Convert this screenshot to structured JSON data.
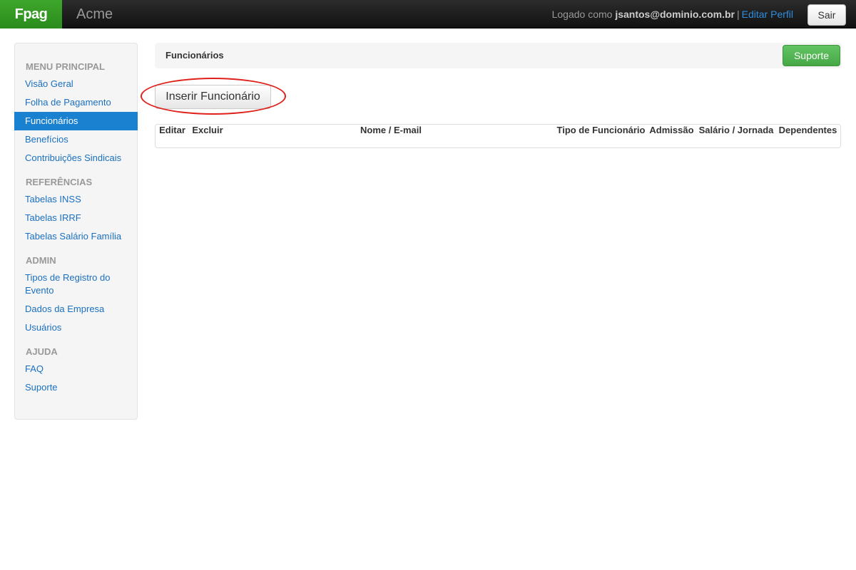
{
  "navbar": {
    "brand": "Fpag",
    "company": "Acme",
    "logged_as_label": "Logado como",
    "user_email": "jsantos@dominio.com.br",
    "separator": "|",
    "edit_profile_label": "Editar Perfil",
    "logout_label": "Sair"
  },
  "sidebar": {
    "sections": [
      {
        "header": "MENU PRINCIPAL",
        "items": [
          "Visão Geral",
          "Folha de Pagamento",
          "Funcionários",
          "Benefícios",
          "Contribuições Sindicais"
        ]
      },
      {
        "header": "REFERÊNCIAS",
        "items": [
          "Tabelas INSS",
          "Tabelas IRRF",
          "Tabelas Salário Família"
        ]
      },
      {
        "header": "ADMIN",
        "items": [
          "Tipos de Registro do Evento",
          "Dados da Empresa",
          "Usuários"
        ]
      },
      {
        "header": "AJUDA",
        "items": [
          "FAQ",
          "Suporte"
        ]
      }
    ],
    "active_item": "Funcionários"
  },
  "main": {
    "page_title": "Funcionários",
    "support_label": "Suporte",
    "insert_label": "Inserir Funcionário",
    "table": {
      "columns": [
        "Editar",
        "Excluir",
        "Nome / E-mail",
        "Tipo de Funcionário",
        "Admissão",
        "Salário / Jornada",
        "Dependentes"
      ],
      "rows": []
    }
  },
  "colors": {
    "brand": "#3ea62b",
    "link": "#1a70c0",
    "active_nav": "#1a80d0",
    "support_button": "#51b651",
    "highlight": "#e0201a",
    "table_header": "#999999"
  }
}
